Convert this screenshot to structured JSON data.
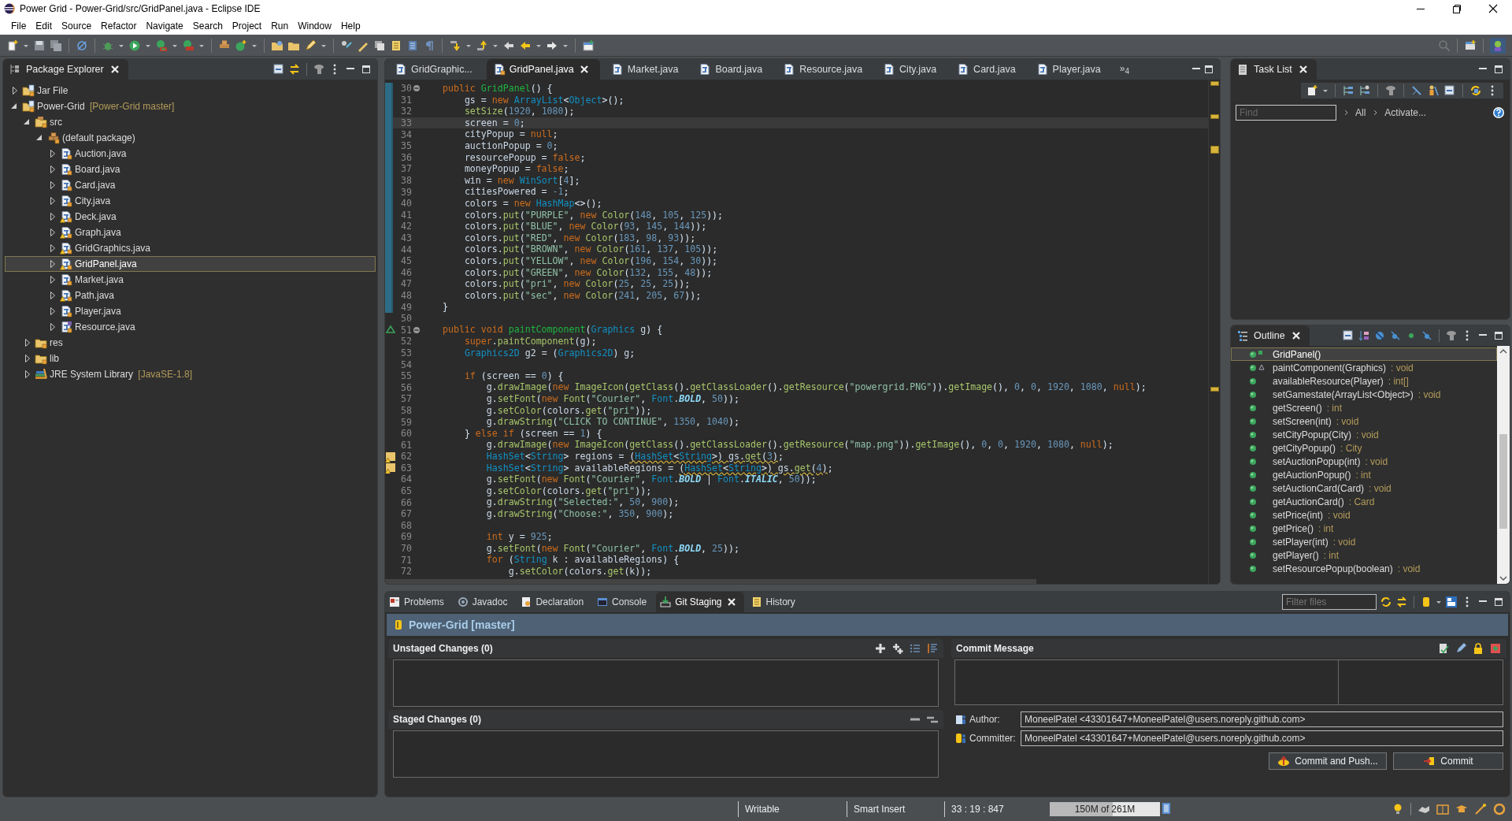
{
  "window": {
    "title": "Power Grid - Power-Grid/src/GridPanel.java - Eclipse IDE"
  },
  "menu": [
    "File",
    "Edit",
    "Source",
    "Refactor",
    "Navigate",
    "Search",
    "Project",
    "Run",
    "Window",
    "Help"
  ],
  "package_explorer": {
    "title": "Package Explorer",
    "tree": [
      {
        "label": "Jar File",
        "kind": "project",
        "expanded": false,
        "selected": false
      },
      {
        "label": "Power-Grid",
        "decoration": "[Power-Grid master]",
        "kind": "project",
        "expanded": true,
        "selected": false,
        "children": [
          {
            "label": "src",
            "kind": "source-folder",
            "expanded": true,
            "selected": false,
            "children": [
              {
                "label": "(default package)",
                "kind": "package",
                "expanded": true,
                "selected": false,
                "children": [
                  {
                    "label": "Auction.java",
                    "kind": "java",
                    "warning": false,
                    "expanded": false,
                    "selected": false
                  },
                  {
                    "label": "Board.java",
                    "kind": "java",
                    "warning": false,
                    "expanded": false,
                    "selected": false
                  },
                  {
                    "label": "Card.java",
                    "kind": "java",
                    "warning": false,
                    "expanded": false,
                    "selected": false
                  },
                  {
                    "label": "City.java",
                    "kind": "java",
                    "warning": false,
                    "expanded": false,
                    "selected": false
                  },
                  {
                    "label": "Deck.java",
                    "kind": "java",
                    "warning": true,
                    "expanded": false,
                    "selected": false
                  },
                  {
                    "label": "Graph.java",
                    "kind": "java",
                    "warning": true,
                    "expanded": false,
                    "selected": false
                  },
                  {
                    "label": "GridGraphics.java",
                    "kind": "java",
                    "warning": true,
                    "expanded": false,
                    "selected": false
                  },
                  {
                    "label": "GridPanel.java",
                    "kind": "java",
                    "warning": true,
                    "expanded": false,
                    "selected": true
                  },
                  {
                    "label": "Market.java",
                    "kind": "java",
                    "warning": false,
                    "expanded": false,
                    "selected": false
                  },
                  {
                    "label": "Path.java",
                    "kind": "java",
                    "warning": true,
                    "expanded": false,
                    "selected": false
                  },
                  {
                    "label": "Player.java",
                    "kind": "java",
                    "warning": false,
                    "expanded": false,
                    "selected": false
                  },
                  {
                    "label": "Resource.java",
                    "kind": "enum",
                    "warning": false,
                    "expanded": false,
                    "selected": false
                  }
                ]
              }
            ]
          },
          {
            "label": "res",
            "kind": "folder",
            "expanded": false,
            "selected": false
          },
          {
            "label": "lib",
            "kind": "folder",
            "expanded": false,
            "selected": false
          },
          {
            "label": "JRE System Library",
            "decoration": "[JavaSE-1.8]",
            "kind": "library",
            "expanded": false,
            "selected": false
          }
        ]
      }
    ]
  },
  "editor": {
    "tabs": [
      {
        "label": "GridGraphic...",
        "selected": false
      },
      {
        "label": "GridPanel.java",
        "selected": true
      },
      {
        "label": "Market.java",
        "selected": false
      },
      {
        "label": "Board.java",
        "selected": false
      },
      {
        "label": "Resource.java",
        "selected": false
      },
      {
        "label": "City.java",
        "selected": false
      },
      {
        "label": "Card.java",
        "selected": false
      },
      {
        "label": "Player.java",
        "selected": false
      }
    ],
    "overflow": "»",
    "overflow_count": "4",
    "lines": [
      {
        "n": "30",
        "kind": "fold",
        "changed": true,
        "current": false,
        "code": "    public GridPanel() {"
      },
      {
        "n": "31",
        "kind": "code",
        "changed": true,
        "current": false,
        "code": "        gs = new ArrayList<Object>();"
      },
      {
        "n": "32",
        "kind": "code",
        "changed": true,
        "current": false,
        "code": "        setSize(1920, 1080);"
      },
      {
        "n": "33",
        "kind": "code",
        "changed": true,
        "current": true,
        "code": "        screen = 0;"
      },
      {
        "n": "34",
        "kind": "code",
        "changed": true,
        "current": false,
        "code": "        cityPopup = null;"
      },
      {
        "n": "35",
        "kind": "code",
        "changed": true,
        "current": false,
        "code": "        auctionPopup = 0;"
      },
      {
        "n": "36",
        "kind": "code",
        "changed": true,
        "current": false,
        "code": "        resourcePopup = false;"
      },
      {
        "n": "37",
        "kind": "code",
        "changed": true,
        "current": false,
        "code": "        moneyPopup = false;"
      },
      {
        "n": "38",
        "kind": "code",
        "changed": true,
        "current": false,
        "code": "        win = new WinSort[4];"
      },
      {
        "n": "39",
        "kind": "code",
        "changed": true,
        "current": false,
        "code": "        citiesPowered = -1;"
      },
      {
        "n": "40",
        "kind": "code",
        "changed": true,
        "current": false,
        "code": "        colors = new HashMap<>();"
      },
      {
        "n": "41",
        "kind": "code",
        "changed": true,
        "current": false,
        "code": "        colors.put(\"PURPLE\", new Color(148, 105, 125));"
      },
      {
        "n": "42",
        "kind": "code",
        "changed": true,
        "current": false,
        "code": "        colors.put(\"BLUE\", new Color(93, 145, 144));"
      },
      {
        "n": "43",
        "kind": "code",
        "changed": true,
        "current": false,
        "code": "        colors.put(\"RED\", new Color(183, 98, 93));"
      },
      {
        "n": "44",
        "kind": "code",
        "changed": true,
        "current": false,
        "code": "        colors.put(\"BROWN\", new Color(161, 137, 105));"
      },
      {
        "n": "45",
        "kind": "code",
        "changed": true,
        "current": false,
        "code": "        colors.put(\"YELLOW\", new Color(196, 154, 30));"
      },
      {
        "n": "46",
        "kind": "code",
        "changed": true,
        "current": false,
        "code": "        colors.put(\"GREEN\", new Color(132, 155, 48));"
      },
      {
        "n": "47",
        "kind": "code",
        "changed": true,
        "current": false,
        "code": "        colors.put(\"pri\", new Color(25, 25, 25));"
      },
      {
        "n": "48",
        "kind": "code",
        "changed": true,
        "current": false,
        "code": "        colors.put(\"sec\", new Color(241, 205, 67));"
      },
      {
        "n": "49",
        "kind": "code",
        "changed": true,
        "current": false,
        "code": "    }"
      },
      {
        "n": "50",
        "kind": "blank",
        "changed": false,
        "current": false
      },
      {
        "n": "51",
        "kind": "override",
        "changed": false,
        "current": false,
        "code": "    public void paintComponent(Graphics g) {"
      },
      {
        "n": "52",
        "kind": "code",
        "changed": false,
        "current": false,
        "code": "        super.paintComponent(g);"
      },
      {
        "n": "53",
        "kind": "code",
        "changed": false,
        "current": false,
        "code": "        Graphics2D g2 = (Graphics2D) g;"
      },
      {
        "n": "54",
        "kind": "blank",
        "changed": false,
        "current": false
      },
      {
        "n": "55",
        "kind": "code",
        "changed": false,
        "current": false,
        "code": "        if (screen == 0) {"
      },
      {
        "n": "56",
        "kind": "code",
        "changed": false,
        "current": false,
        "code": "            g.drawImage(new ImageIcon(getClass().getClassLoader().getResource(\"powergrid.PNG\")).getImage(), 0, 0, 1920, 1080, null);"
      },
      {
        "n": "57",
        "kind": "code",
        "changed": false,
        "current": false,
        "code": "            g.setFont(new Font(\"Courier\", Font.BOLD, 50));"
      },
      {
        "n": "58",
        "kind": "code",
        "changed": false,
        "current": false,
        "code": "            g.setColor(colors.get(\"pri\"));"
      },
      {
        "n": "59",
        "kind": "code",
        "changed": false,
        "current": false,
        "code": "            g.drawString(\"CLICK TO CONTINUE\", 1350, 1040);"
      },
      {
        "n": "60",
        "kind": "code",
        "changed": false,
        "current": false,
        "code": "        } else if (screen == 1) {"
      },
      {
        "n": "61",
        "kind": "code",
        "changed": false,
        "current": false,
        "code": "            g.drawImage(new ImageIcon(getClass().getClassLoader().getResource(\"map.png\")).getImage(), 0, 0, 1920, 1080, null);"
      },
      {
        "n": "62",
        "kind": "warning",
        "changed": false,
        "current": false,
        "code": "            HashSet<String> regions = (HashSet<String>) gs.get(3);"
      },
      {
        "n": "63",
        "kind": "warning",
        "changed": false,
        "current": false,
        "code": "            HashSet<String> availableRegions = (HashSet<String>) gs.get(4);"
      },
      {
        "n": "64",
        "kind": "code",
        "changed": false,
        "current": false,
        "code": "            g.setFont(new Font(\"Courier\", Font.BOLD | Font.ITALIC, 50));"
      },
      {
        "n": "65",
        "kind": "code",
        "changed": false,
        "current": false,
        "code": "            g.setColor(colors.get(\"pri\"));"
      },
      {
        "n": "66",
        "kind": "code",
        "changed": false,
        "current": false,
        "code": "            g.drawString(\"Selected:\", 50, 900);"
      },
      {
        "n": "67",
        "kind": "code",
        "changed": false,
        "current": false,
        "code": "            g.drawString(\"Choose:\", 350, 900);"
      },
      {
        "n": "68",
        "kind": "blank",
        "changed": false,
        "current": false
      },
      {
        "n": "69",
        "kind": "code",
        "changed": false,
        "current": false,
        "code": "            int y = 925;"
      },
      {
        "n": "70",
        "kind": "code",
        "changed": false,
        "current": false,
        "code": "            g.setFont(new Font(\"Courier\", Font.BOLD, 25));"
      },
      {
        "n": "71",
        "kind": "code",
        "changed": false,
        "current": false,
        "code": "            for (String k : availableRegions) {"
      },
      {
        "n": "72",
        "kind": "code",
        "changed": false,
        "current": false,
        "code": "                g.setColor(colors.get(k));"
      }
    ]
  },
  "task_list": {
    "title": "Task List",
    "find": {
      "placeholder": "Find"
    },
    "links": [
      "All",
      "Activate..."
    ]
  },
  "outline": {
    "title": "Outline",
    "items": [
      {
        "name": "GridPanel()",
        "kind": "constructor",
        "selected": true
      },
      {
        "name": "paintComponent(Graphics)",
        "type": ": void",
        "kind": "override",
        "selected": false
      },
      {
        "name": "availableResource(Player)",
        "type": ": int[]",
        "kind": "method",
        "selected": false
      },
      {
        "name": "setGamestate(ArrayList<Object>)",
        "type": ": void",
        "kind": "method",
        "selected": false
      },
      {
        "name": "getScreen()",
        "type": ": int",
        "kind": "method",
        "selected": false
      },
      {
        "name": "setScreen(int)",
        "type": ": void",
        "kind": "method",
        "selected": false
      },
      {
        "name": "setCityPopup(City)",
        "type": ": void",
        "kind": "method",
        "selected": false
      },
      {
        "name": "getCityPopup()",
        "type": ": City",
        "kind": "method",
        "selected": false
      },
      {
        "name": "setAuctionPopup(int)",
        "type": ": void",
        "kind": "method",
        "selected": false
      },
      {
        "name": "getAuctionPopup()",
        "type": ": int",
        "kind": "method",
        "selected": false
      },
      {
        "name": "setAuctionCard(Card)",
        "type": ": void",
        "kind": "method",
        "selected": false
      },
      {
        "name": "getAuctionCard()",
        "type": ": Card",
        "kind": "method",
        "selected": false
      },
      {
        "name": "setPrice(int)",
        "type": ": void",
        "kind": "method",
        "selected": false
      },
      {
        "name": "getPrice()",
        "type": ": int",
        "kind": "method",
        "selected": false
      },
      {
        "name": "setPlayer(int)",
        "type": ": void",
        "kind": "method",
        "selected": false
      },
      {
        "name": "getPlayer()",
        "type": ": int",
        "kind": "method",
        "selected": false
      },
      {
        "name": "setResourcePopup(boolean)",
        "type": ": void",
        "kind": "method",
        "selected": false
      }
    ]
  },
  "bottom": {
    "tabs": [
      {
        "label": "Problems",
        "selected": false
      },
      {
        "label": "Javadoc",
        "selected": false
      },
      {
        "label": "Declaration",
        "selected": false
      },
      {
        "label": "Console",
        "selected": false
      },
      {
        "label": "Git Staging",
        "selected": true
      },
      {
        "label": "History",
        "selected": false
      }
    ],
    "filter": {
      "placeholder": "Filter files"
    },
    "repository": "Power-Grid [master]",
    "unstaged": "Unstaged Changes (0)",
    "staged": "Staged Changes (0)",
    "commit_message": "Commit Message",
    "author": {
      "label": "Author:",
      "value": "MoneelPatel <43301647+MoneelPatel@users.noreply.github.com>"
    },
    "committer": {
      "label": "Committer:",
      "value": "MoneelPatel <43301647+MoneelPatel@users.noreply.github.com>"
    },
    "buttons": [
      "Commit and Push...",
      "Commit"
    ]
  },
  "status_bar": {
    "mode": "Writable",
    "insert": "Smart Insert",
    "position": "33 : 19 : 847",
    "memory": {
      "text": "150M of 261M",
      "level": 0.57
    }
  }
}
